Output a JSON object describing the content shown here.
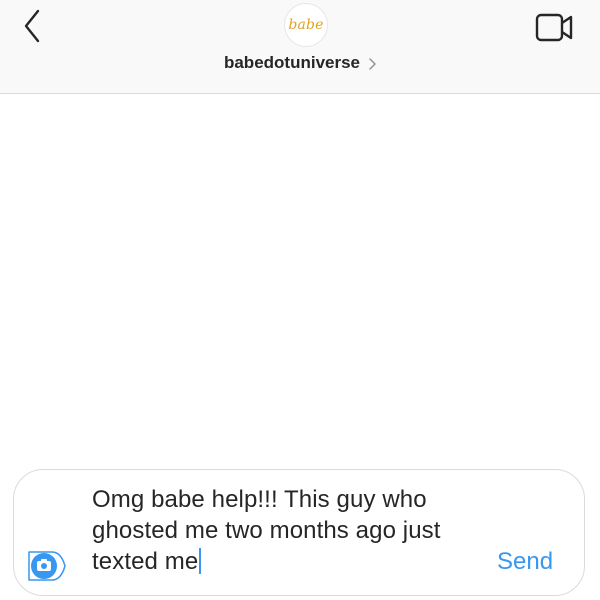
{
  "header": {
    "avatar_text": "babe",
    "username": "babedotuniverse",
    "icons": {
      "back": "chevron-left-icon",
      "profile": "chevron-right-icon",
      "video": "video-camera-icon"
    }
  },
  "composer": {
    "message_text": "Omg babe help!!! This guy who ghosted me two months ago just texted me",
    "send_label": "Send",
    "camera_icon": "camera-icon"
  },
  "colors": {
    "accent": "#3897f0",
    "text": "#262626",
    "header_bg": "#f9f9f9",
    "logo_gold": "#e0a31f"
  }
}
